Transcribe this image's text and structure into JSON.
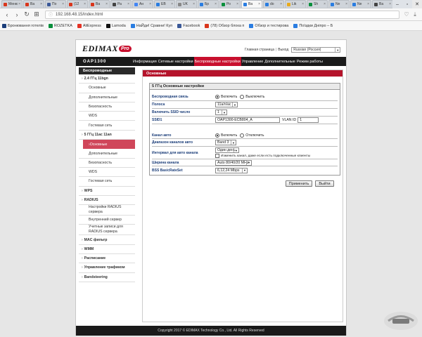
{
  "browser": {
    "tabs": [
      {
        "label": "Меню",
        "color": "#d9361c"
      },
      {
        "label": "Ва",
        "color": "#d9361c"
      },
      {
        "label": "По",
        "color": "#3b5998"
      },
      {
        "label": "(12",
        "color": "#d9361c"
      },
      {
        "label": "Ва",
        "color": "#d9361c"
      },
      {
        "label": "Ра",
        "color": "#444444"
      },
      {
        "label": "Ан",
        "color": "#4285f4"
      },
      {
        "label": "ЕВ",
        "color": "#2a7de1"
      },
      {
        "label": "UK",
        "color": "#888888"
      },
      {
        "label": "Бр",
        "color": "#2a7de1"
      },
      {
        "label": "Ро",
        "color": "#0a8f3c"
      },
      {
        "label": "Ва",
        "color": "#2a7de1"
      },
      {
        "label": "do",
        "color": "#2a7de1"
      },
      {
        "label": "Lik",
        "color": "#e9aa1a"
      },
      {
        "label": "Sh",
        "color": "#0a8f3c"
      },
      {
        "label": "Ne",
        "color": "#2a7de1"
      },
      {
        "label": "Ne",
        "color": "#2a7de1"
      },
      {
        "label": "Ва",
        "color": "#444444"
      },
      {
        "label": "no",
        "color": "#2a7de1"
      }
    ],
    "address": "192.168.48.15/index.html",
    "bookmarks": [
      {
        "label": "Бронювання готелів",
        "color": "#1b3e7a"
      },
      {
        "label": "ROZETKA",
        "color": "#0a8f3c"
      },
      {
        "label": "AliExpress",
        "color": "#e43225"
      },
      {
        "label": "Lamoda",
        "color": "#111111"
      },
      {
        "label": "НаЙди! Сравни! Куп",
        "color": "#2a7de1"
      },
      {
        "label": "Facebook",
        "color": "#3b5998"
      },
      {
        "label": "(78) Обзор блока п",
        "color": "#d9361c"
      },
      {
        "label": "Обзор и тестирова",
        "color": "#2a7de1"
      },
      {
        "label": "Поїздки Дніпро – Б",
        "color": "#2a7de1"
      }
    ]
  },
  "router": {
    "brand": "EDIMAX",
    "brand_pro": "Pro",
    "model": "OAP1300",
    "home_link": "Главная страница",
    "sep": "|",
    "logout_link": "Выход",
    "language": "Russian (Россия)",
    "menu": [
      "Информация",
      "Сетевые настройки",
      "Беспроводные настройки",
      "Управление",
      "Дополнительные",
      "Режим работы"
    ],
    "active_menu": 2,
    "sidebar_title": "Беспроводные",
    "content_title": "Основные",
    "fieldset_title": "5 ГГц Основные настройки",
    "footer": "Copyright 2017 © EDIMAX Technology Co., Ltd. All Rights Reserved"
  },
  "sidebar": [
    {
      "label": "2.4 ГГц 11bgn",
      "type": "group"
    },
    {
      "label": "Основные",
      "type": "sub"
    },
    {
      "label": "Дополнительные",
      "type": "sub"
    },
    {
      "label": "Безопасность",
      "type": "sub"
    },
    {
      "label": "WDS",
      "type": "sub"
    },
    {
      "label": "Гостевая сеть",
      "type": "sub"
    },
    {
      "label": "5 ГГц 11ac 11an",
      "type": "group"
    },
    {
      "label": "Основные",
      "type": "active"
    },
    {
      "label": "Дополнительные",
      "type": "sub"
    },
    {
      "label": "Безопасность",
      "type": "sub"
    },
    {
      "label": "WDS",
      "type": "sub"
    },
    {
      "label": "Гостевая сеть",
      "type": "sub"
    },
    {
      "label": "WPS",
      "type": "group"
    },
    {
      "label": "RADIUS",
      "type": "group"
    },
    {
      "label": "Настройки RADIUS",
      "label2": "сервера",
      "type": "sub2"
    },
    {
      "label": "Внутренний сервер",
      "type": "sub"
    },
    {
      "label": "Учетные записи для",
      "label2": "RADIUS сервера",
      "type": "sub2"
    },
    {
      "label": "MAC фильтр",
      "type": "group"
    },
    {
      "label": "WMM",
      "type": "group"
    },
    {
      "label": "Расписание",
      "type": "group"
    },
    {
      "label": "Управление трафиком",
      "type": "group"
    },
    {
      "label": "Bandsteering",
      "type": "group"
    }
  ],
  "form": {
    "wireless_label": "Беспроводная связь",
    "wireless_on": "Включить",
    "wireless_off": "Выключить",
    "band_label": "Полоса",
    "band_value": "11a/n/ac",
    "ssid_count_label": "Включить SSID число",
    "ssid_count_value": "1",
    "ssid1_label": "SSID1",
    "ssid1_value": "OAP1300-ECB804_A",
    "vlan_label": "VLAN ID",
    "vlan_value": "1",
    "auto_channel_label": "Канал авто",
    "auto_on": "Включить",
    "auto_off": "Отключить",
    "auto_range_label": "Диапазон каналов авто",
    "auto_range_value": "Band 3",
    "auto_interval_label": "Интервал для авто канала",
    "auto_interval_value": "Один день",
    "auto_interval_check": "Изменить канал, даже если есть подключенные клиенты",
    "channel_width_label": "Ширина канала",
    "channel_width_value": "Auto 80/40/20 MHz",
    "bss_label": "BSS BasicRateSet",
    "bss_value": "6,12,24 Mbps",
    "apply_button": "Применить",
    "cancel_button": "Выйти"
  }
}
